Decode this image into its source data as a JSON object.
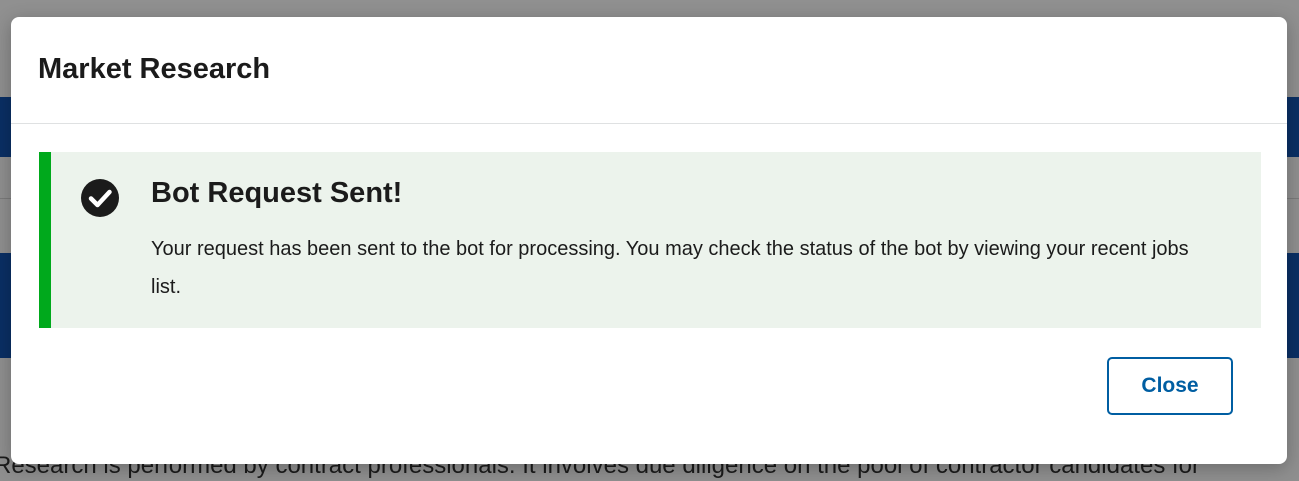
{
  "modal": {
    "title": "Market Research",
    "alert": {
      "status": "success",
      "icon": "check-circle-icon",
      "heading": "Bot Request Sent!",
      "body": "Your request has been sent to the bot for processing. You may check the status of the bot by viewing your recent jobs list."
    },
    "close_label": "Close"
  },
  "background": {
    "paragraph_fragment": "Research is performed by contract professionals. It involves due diligence on the pool of contractor candidates for"
  },
  "colors": {
    "success_accent": "#00a91c",
    "alert_background": "#ecf3ec",
    "primary": "#005ea2",
    "header_band": "#0a2f64"
  }
}
